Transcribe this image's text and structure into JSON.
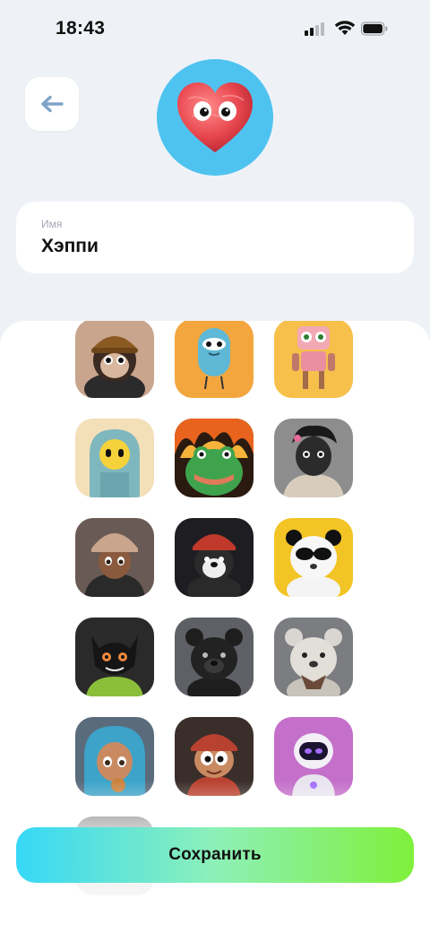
{
  "status_bar": {
    "time": "18:43",
    "icons": [
      "cellular-signal-icon",
      "wifi-icon",
      "battery-icon"
    ]
  },
  "header": {
    "back_icon": "arrow-left-icon",
    "avatar": {
      "name": "heart-character",
      "background": "#4fc3f0"
    }
  },
  "name_field": {
    "label": "Имя",
    "value": "Хэппи"
  },
  "avatars": [
    {
      "name": "monkey-beanie",
      "bg": "#c9a58e"
    },
    {
      "name": "blue-monster",
      "bg": "#f3a63e"
    },
    {
      "name": "pink-robot",
      "bg": "#f6c04a"
    },
    {
      "name": "hooded-emoji",
      "bg": "#f3dfb8"
    },
    {
      "name": "fire-frog",
      "bg": "#2a1a10"
    },
    {
      "name": "masked-boy",
      "bg": "#8d8d8d"
    },
    {
      "name": "girl-beanie",
      "bg": "#6a5a55"
    },
    {
      "name": "dog-beanie",
      "bg": "#1e1e22"
    },
    {
      "name": "panda-sunglasses",
      "bg": "#f2c425"
    },
    {
      "name": "black-cat",
      "bg": "#2a2a2a"
    },
    {
      "name": "black-bear",
      "bg": "#5e6066"
    },
    {
      "name": "grey-bear",
      "bg": "#7b7d80"
    },
    {
      "name": "girl-blue-hood",
      "bg": "#5a6b7c"
    },
    {
      "name": "cartoon-boy-cap",
      "bg": "#3a2e2a"
    },
    {
      "name": "purple-robot",
      "bg": "#c46fc9"
    },
    {
      "name": "partial-avatar",
      "bg": "#707070"
    }
  ],
  "save_button": {
    "label": "Сохранить"
  },
  "colors": {
    "background": "#eef2f7",
    "card": "#ffffff",
    "button_gradient": [
      "#36d8f7",
      "#8df0b8",
      "#7ff03a"
    ]
  }
}
